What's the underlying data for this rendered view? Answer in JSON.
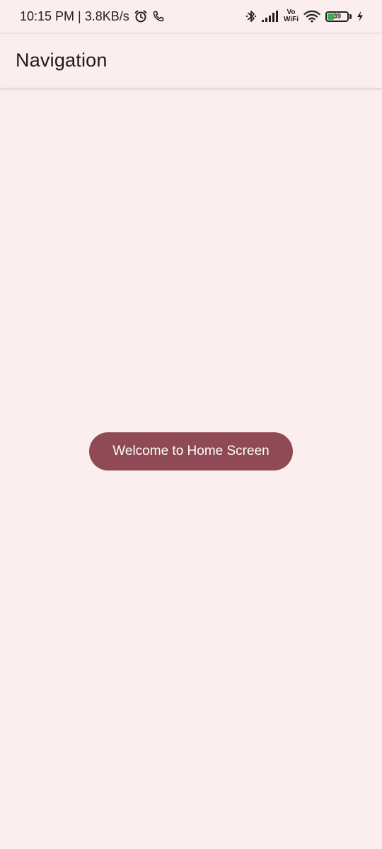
{
  "status_bar": {
    "time_speed": "10:15 PM | 3.8KB/s",
    "vowifi_top": "Vo",
    "vowifi_bottom": "WiFi",
    "battery_level": "39",
    "battery_fraction": 0.39,
    "icons": [
      "alarm-icon",
      "phone-call-icon",
      "bluetooth-icon",
      "signal-icon",
      "wifi-icon",
      "battery-icon",
      "charging-icon"
    ]
  },
  "app_bar": {
    "title": "Navigation"
  },
  "main": {
    "button_label": "Welcome to Home Screen"
  },
  "colors": {
    "background": "#faeeee",
    "primary": "#8f4a55",
    "on_primary": "#ffffff",
    "battery_fill": "#2fb74b"
  }
}
